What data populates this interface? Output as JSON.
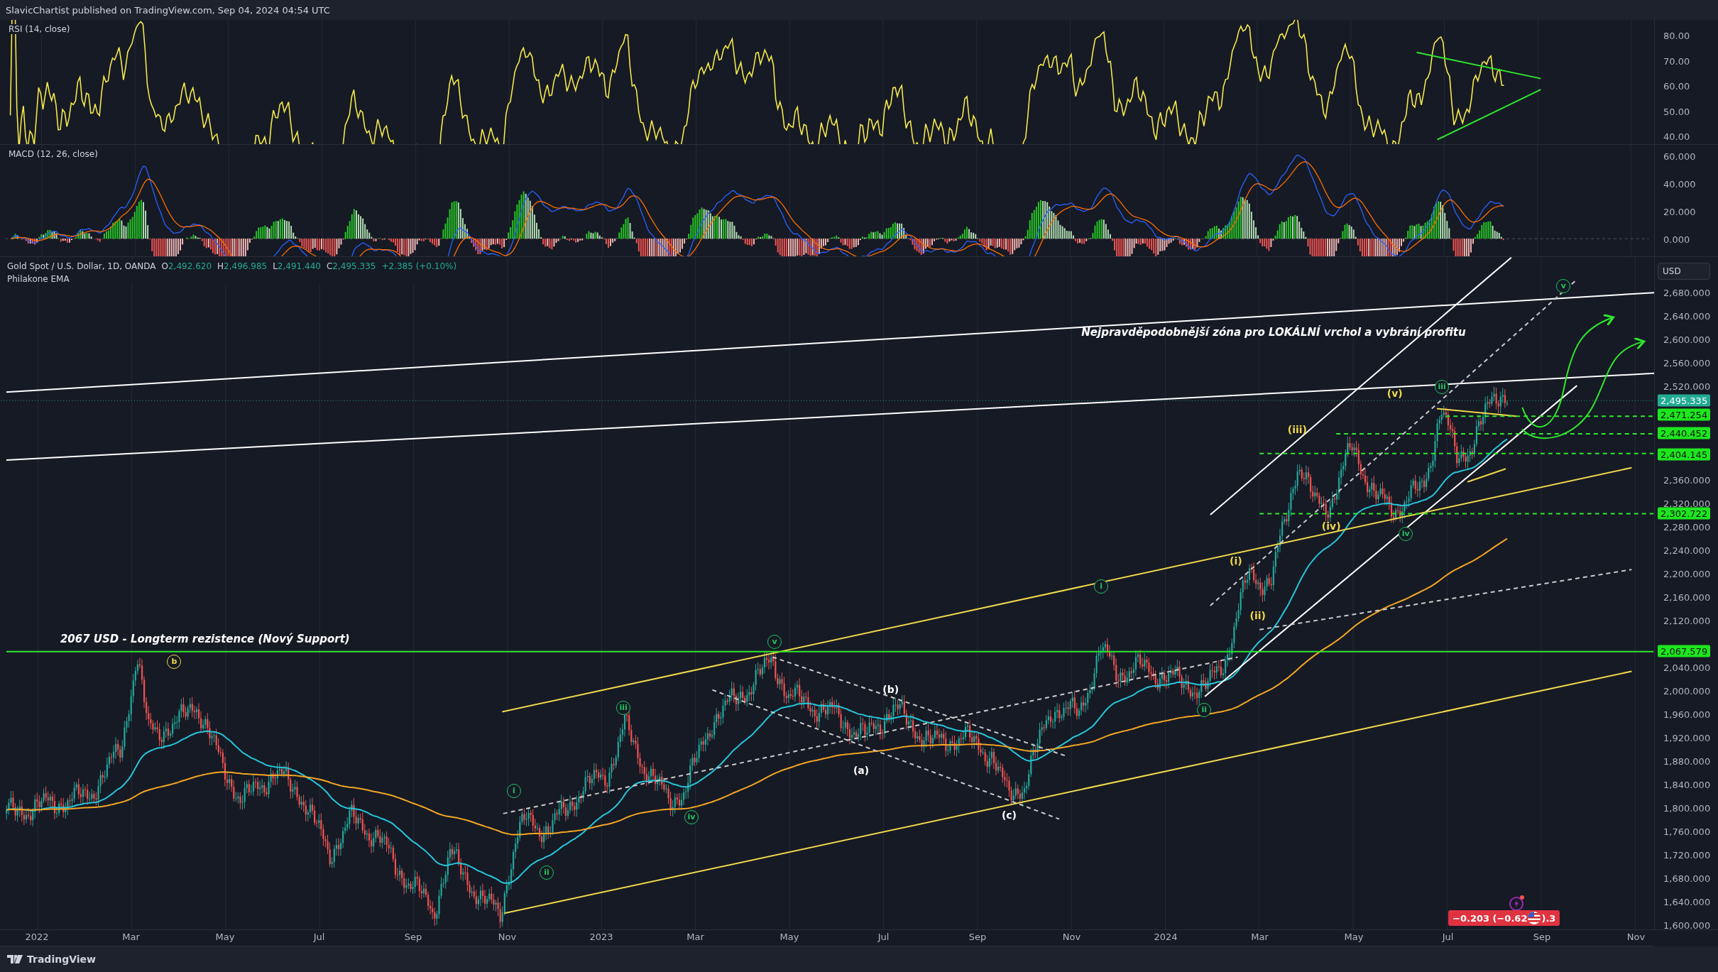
{
  "header": {
    "title": "SlavicChartist published on TradingView.com, Sep 04, 2024 04:54 UTC"
  },
  "rsi_pane": {
    "title": "RSI (14, close)",
    "axis": [
      "80.00",
      "70.00",
      "60.00",
      "50.00",
      "40.00"
    ]
  },
  "macd_pane": {
    "title": "MACD (12, 26, close)",
    "axis": [
      "60.000",
      "40.000",
      "20.000",
      "0.000"
    ]
  },
  "price_pane": {
    "symbol": "Gold Spot / U.S. Dollar, 1D, OANDA",
    "ohlc": [
      {
        "key": "O",
        "value": "2,492.620"
      },
      {
        "key": "H",
        "value": "2,496.985"
      },
      {
        "key": "L",
        "value": "2,491.440"
      },
      {
        "key": "C",
        "value": "2,495.335"
      }
    ],
    "change": "+2.385 (+0.10%)",
    "indicator": "Philakone EMA",
    "currency_button": "USD",
    "axis": [
      "2,680.000",
      "2,640.000",
      "2,600.000",
      "2,560.000",
      "2,520.000",
      "2,360.000",
      "2,320.000",
      "2,280.000",
      "2,240.000",
      "2,200.000",
      "2,160.000",
      "2,120.000",
      "2,040.000",
      "2,000.000",
      "1,960.000",
      "1,920.000",
      "1,880.000",
      "1,840.000",
      "1,800.000",
      "1,760.000",
      "1,720.000",
      "1,680.000",
      "1,640.000",
      "1,600.000"
    ],
    "price_labels": [
      {
        "text": "2,495.335",
        "color": "#22ab94"
      },
      {
        "text": "2,471.254",
        "color": "#1ee61e"
      },
      {
        "text": "2,440.452",
        "color": "#1ee61e"
      },
      {
        "text": "2,404.145",
        "color": "#1ee61e"
      },
      {
        "text": "2,302.722",
        "color": "#1ee61e"
      },
      {
        "text": "2,067.579",
        "color": "#1ee61e"
      }
    ],
    "annotations": [
      "Nejpravděpodobnější zóna pro LOKÁLNÍ vrchol a vybrání profitu",
      "2067 USD - Longterm rezistence (Nový Support)"
    ],
    "wave_labels": [
      {
        "text": "b",
        "kind": "circled",
        "color": "#f0d84a"
      },
      {
        "text": "i",
        "kind": "circled",
        "color": "#22c55e"
      },
      {
        "text": "ii",
        "kind": "circled",
        "color": "#22c55e"
      },
      {
        "text": "iii",
        "kind": "circled",
        "color": "#22c55e"
      },
      {
        "text": "iv",
        "kind": "circled",
        "color": "#22c55e"
      },
      {
        "text": "v",
        "kind": "circled",
        "color": "#22c55e"
      },
      {
        "text": "(a)",
        "kind": "plain",
        "color": "#ffffff"
      },
      {
        "text": "(b)",
        "kind": "plain",
        "color": "#ffffff"
      },
      {
        "text": "(c)",
        "kind": "plain",
        "color": "#ffffff"
      },
      {
        "text": "i",
        "kind": "circled",
        "color": "#22c55e"
      },
      {
        "text": "ii",
        "kind": "circled",
        "color": "#22c55e"
      },
      {
        "text": "(i)",
        "kind": "plain",
        "color": "#f0d84a"
      },
      {
        "text": "(ii)",
        "kind": "plain",
        "color": "#f0d84a"
      },
      {
        "text": "(iii)",
        "kind": "plain",
        "color": "#f0d84a"
      },
      {
        "text": "(iv)",
        "kind": "plain",
        "color": "#f0d84a"
      },
      {
        "text": "iv",
        "kind": "circled",
        "color": "#22c55e"
      },
      {
        "text": "(v)",
        "kind": "plain",
        "color": "#f0d84a"
      },
      {
        "text": "iii",
        "kind": "circled",
        "color": "#22c55e"
      },
      {
        "text": "v",
        "kind": "circled",
        "color": "#22c55e"
      }
    ],
    "change_badge": {
      "text_before": "−0.203 (−0.62",
      "text_after": ").3"
    }
  },
  "time_axis": [
    "2022",
    "Mar",
    "May",
    "Jul",
    "Sep",
    "Nov",
    "2023",
    "Mar",
    "May",
    "Jul",
    "Sep",
    "Nov",
    "2024",
    "Mar",
    "May",
    "Jul",
    "Sep",
    "Nov"
  ],
  "footer": {
    "brand": "TradingView"
  }
}
